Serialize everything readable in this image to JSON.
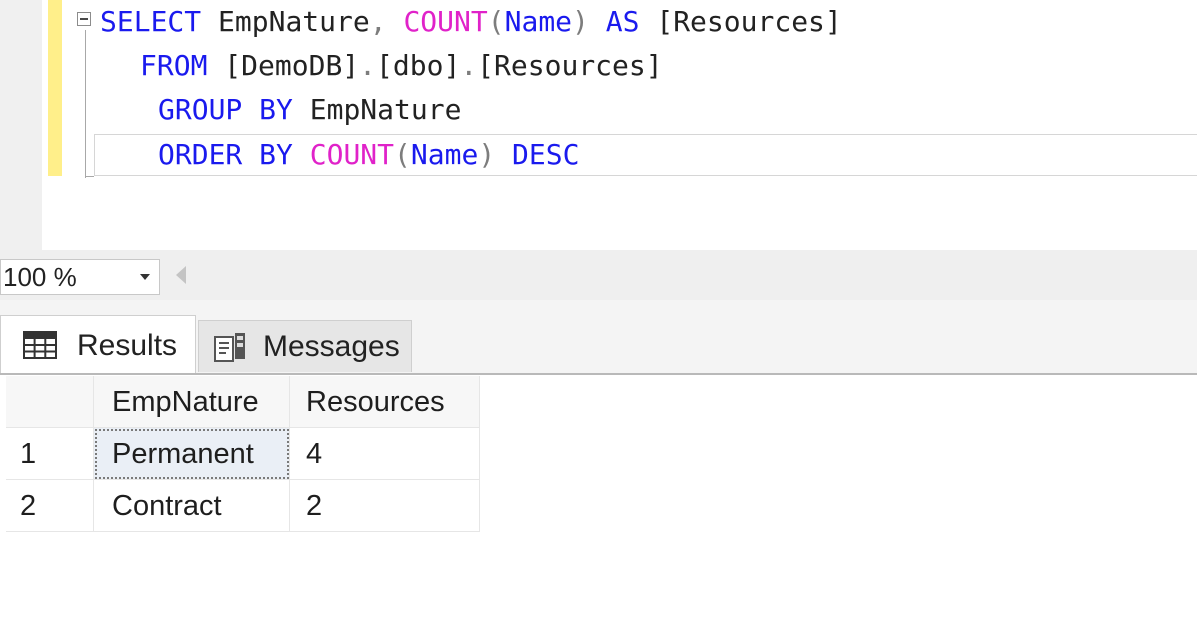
{
  "editor": {
    "lines": [
      [
        {
          "t": "SELECT",
          "c": "kw"
        },
        {
          "t": " EmpNature",
          "c": "nm"
        },
        {
          "t": ",",
          "c": "pn"
        },
        {
          "t": " ",
          "c": "nm"
        },
        {
          "t": "COUNT",
          "c": "fn"
        },
        {
          "t": "(",
          "c": "pn"
        },
        {
          "t": "Name",
          "c": "kw"
        },
        {
          "t": ")",
          "c": "pn"
        },
        {
          "t": " ",
          "c": "nm"
        },
        {
          "t": "AS",
          "c": "kw"
        },
        {
          "t": " [Resources]",
          "c": "nm"
        }
      ],
      [
        {
          "t": "FROM",
          "c": "kw"
        },
        {
          "t": " [DemoDB]",
          "c": "nm"
        },
        {
          "t": ".",
          "c": "pn"
        },
        {
          "t": "[dbo]",
          "c": "nm"
        },
        {
          "t": ".",
          "c": "pn"
        },
        {
          "t": "[Resources]",
          "c": "nm"
        }
      ],
      [
        {
          "t": "GROUP",
          "c": "kw"
        },
        {
          "t": " ",
          "c": "nm"
        },
        {
          "t": "BY",
          "c": "kw"
        },
        {
          "t": " EmpNature",
          "c": "nm"
        }
      ],
      [
        {
          "t": "ORDER",
          "c": "kw"
        },
        {
          "t": " ",
          "c": "nm"
        },
        {
          "t": "BY",
          "c": "kw"
        },
        {
          "t": " ",
          "c": "nm"
        },
        {
          "t": "COUNT",
          "c": "fn"
        },
        {
          "t": "(",
          "c": "pn"
        },
        {
          "t": "Name",
          "c": "kw"
        },
        {
          "t": ")",
          "c": "pn"
        },
        {
          "t": " ",
          "c": "nm"
        },
        {
          "t": "DESC",
          "c": "kw"
        }
      ]
    ]
  },
  "zoom": {
    "value": "100 %"
  },
  "tabs": {
    "results": "Results",
    "messages": "Messages"
  },
  "grid": {
    "columns": [
      "EmpNature",
      "Resources"
    ],
    "rows": [
      {
        "num": "1",
        "emp_nature": "Permanent",
        "resources": "4"
      },
      {
        "num": "2",
        "emp_nature": "Contract",
        "resources": "2"
      }
    ]
  },
  "colors": {
    "keyword": "#1a1aee",
    "function": "#e022c9",
    "punctuation": "#7d7d7d",
    "change_bar": "#ffef8a"
  }
}
